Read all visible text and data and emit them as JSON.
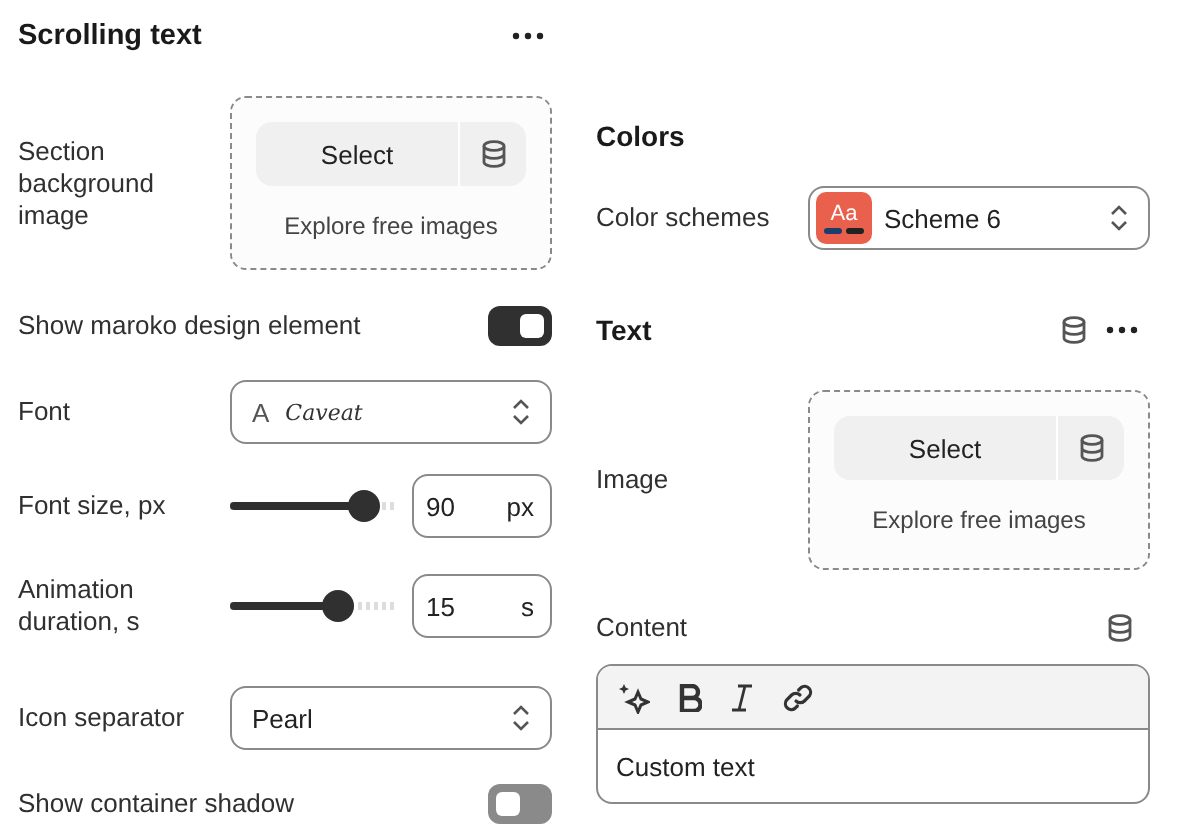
{
  "left": {
    "title": "Scrolling text",
    "settings": [
      {
        "kind": "image",
        "label": "Section background image",
        "button": "Select",
        "link": "Explore free images"
      },
      {
        "kind": "toggle",
        "label": "Show maroko design element",
        "on": true
      },
      {
        "kind": "font",
        "label": "Font",
        "value": "Caveat",
        "glyph": "A"
      },
      {
        "kind": "slider",
        "label": "Font size, px",
        "level": 0.9,
        "value": "90",
        "unit": "px"
      },
      {
        "kind": "slider",
        "label": "Animation duration, s",
        "level": 0.7,
        "value": "15",
        "unit": "s"
      },
      {
        "kind": "select",
        "label": "Icon separator",
        "value": "Pearl"
      },
      {
        "kind": "toggle",
        "label": "Show container shadow",
        "on": false
      }
    ]
  },
  "right": [
    {
      "title": "Colors",
      "settings": [
        {
          "kind": "scheme",
          "label": "Color schemes",
          "swatch": "Aa",
          "value": "Scheme 6"
        }
      ]
    },
    {
      "title": "Text",
      "settings": [
        {
          "kind": "image",
          "label": "Image",
          "button": "Select",
          "link": "Explore free images"
        },
        {
          "kind": "richtext",
          "label": "Content",
          "value": "Custom text"
        }
      ]
    }
  ]
}
